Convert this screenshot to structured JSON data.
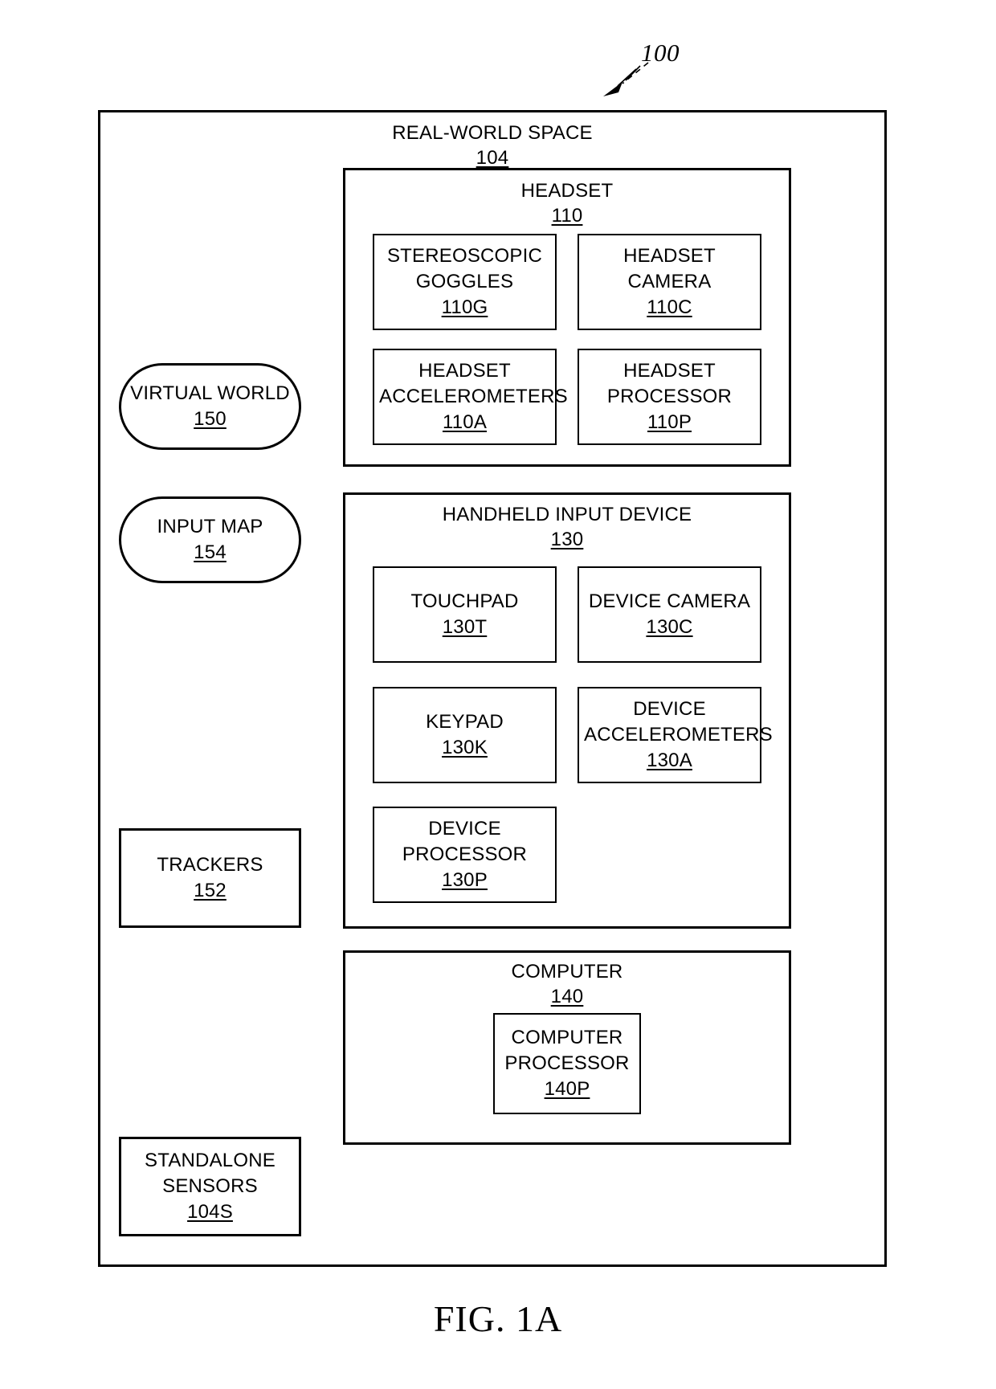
{
  "figure": {
    "callout_number": "100",
    "caption": "FIG.  1A"
  },
  "real_world_space": {
    "title": "REAL-WORLD SPACE",
    "ref": "104"
  },
  "left_nodes": [
    {
      "name": "virtual-world",
      "label": "VIRTUAL WORLD",
      "ref": "150",
      "shape": "rounded"
    },
    {
      "name": "input-map",
      "label": "INPUT MAP",
      "ref": "154",
      "shape": "rounded"
    },
    {
      "name": "trackers",
      "label": "TRACKERS",
      "ref": "152",
      "shape": "rect"
    },
    {
      "name": "standalone-sensors",
      "label": "STANDALONE\nSENSORS",
      "line1": "STANDALONE",
      "line2": "SENSORS",
      "ref": "104S",
      "shape": "rect"
    }
  ],
  "headset": {
    "title": "HEADSET",
    "ref": "110",
    "components": [
      {
        "name": "stereoscopic-goggles",
        "line1": "STEREOSCOPIC",
        "line2": "GOGGLES",
        "ref": "110G"
      },
      {
        "name": "headset-camera",
        "line1": "HEADSET CAMERA",
        "line2": "",
        "ref": "110C"
      },
      {
        "name": "headset-accelerometers",
        "line1": "HEADSET",
        "line2": "ACCELEROMETERS",
        "ref": "110A"
      },
      {
        "name": "headset-processor",
        "line1": "HEADSET",
        "line2": "PROCESSOR",
        "ref": "110P"
      }
    ]
  },
  "handheld_input_device": {
    "title": "HANDHELD INPUT DEVICE",
    "ref": "130",
    "components": [
      {
        "name": "touchpad",
        "line1": "TOUCHPAD",
        "line2": "",
        "ref": "130T"
      },
      {
        "name": "device-camera",
        "line1": "DEVICE CAMERA",
        "line2": "",
        "ref": "130C"
      },
      {
        "name": "keypad",
        "line1": "KEYPAD",
        "line2": "",
        "ref": "130K"
      },
      {
        "name": "device-accelerometers",
        "line1": "DEVICE",
        "line2": "ACCELEROMETERS",
        "ref": "130A"
      },
      {
        "name": "device-processor",
        "line1": "DEVICE",
        "line2": "PROCESSOR",
        "ref": "130P"
      }
    ]
  },
  "computer": {
    "title": "COMPUTER",
    "ref": "140",
    "components": [
      {
        "name": "computer-processor",
        "line1": "COMPUTER",
        "line2": "PROCESSOR",
        "ref": "140P"
      }
    ]
  },
  "colors": {
    "stroke": "#000000",
    "background": "#ffffff"
  }
}
